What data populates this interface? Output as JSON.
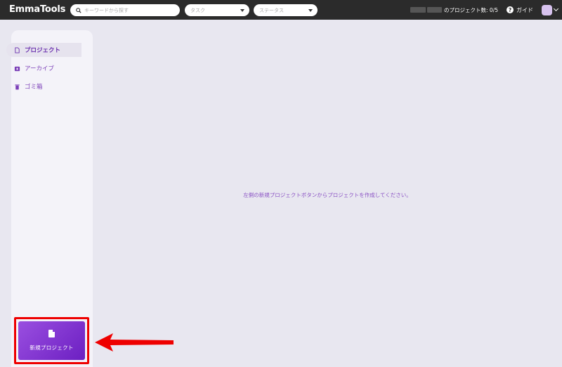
{
  "app": {
    "title": "EmmaTools"
  },
  "search": {
    "placeholder": "キーワードから探す"
  },
  "filters": {
    "task": {
      "value": "タスク"
    },
    "status": {
      "value": "ステータス"
    }
  },
  "header": {
    "project_count": "のプロジェクト数: 0/5",
    "guide_label": "ガイド",
    "guide_icon": "?"
  },
  "sidebar": {
    "items": [
      {
        "label": "プロジェクト",
        "icon": "document-icon",
        "active": true
      },
      {
        "label": "アーカイブ",
        "icon": "archive-icon",
        "active": false
      },
      {
        "label": "ゴミ箱",
        "icon": "trash-icon",
        "active": false
      }
    ],
    "new_project_label": "新規プロジェクト"
  },
  "main": {
    "empty_message": "左側の新規プロジェクトボタンからプロジェクトを作成してください。"
  },
  "colors": {
    "topbar": "#2b2b2b",
    "accent": "#7b3fb8",
    "background": "#e8e7f0",
    "highlight": "#ee0000"
  }
}
